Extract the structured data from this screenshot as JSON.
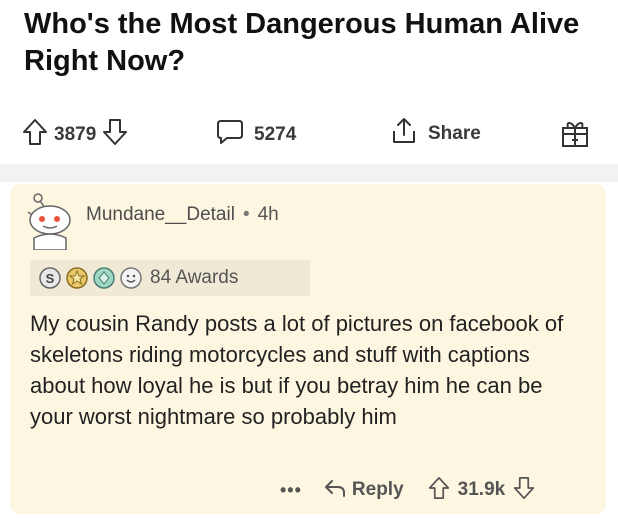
{
  "post": {
    "title": "Who's the Most Dangerous Human Alive Right Now?",
    "score": "3879",
    "comment_count": "5274",
    "share_label": "Share"
  },
  "comment": {
    "username": "Mundane__Detail",
    "separator": "•",
    "age": "4h",
    "awards_label": "84 Awards",
    "body": "My cousin Randy posts a lot of pictures on facebook of skeletons riding motorcycles and stuff with captions about how loyal he is but if you betray him he can be your worst nightmare so probably him",
    "more_label": "•••",
    "reply_label": "Reply",
    "score": "31.9k"
  },
  "icons": {
    "upvote": "upvote-arrow-icon",
    "downvote": "downvote-arrow-icon",
    "comment": "speech-bubble-icon",
    "share": "share-icon",
    "award": "gift-icon",
    "reply": "reply-arrow-icon"
  },
  "colors": {
    "comment_background": "#fdf6e1",
    "awards_background": "#f0e9d6",
    "divider": "#f2f2f2",
    "text": "#1c1c1c",
    "meta_text": "#555555"
  }
}
